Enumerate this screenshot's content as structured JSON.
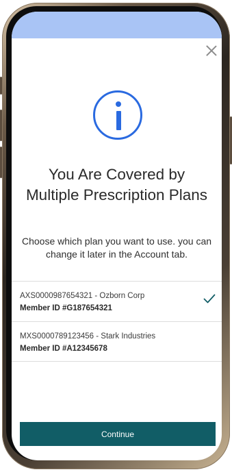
{
  "modal": {
    "title": "You Are Covered by Multiple Prescription Plans",
    "subtitle": "Choose which plan you want to use. you can change it later in the Account tab.",
    "close_icon": "close-icon",
    "info_icon": "info-icon"
  },
  "plans": [
    {
      "name": "AXS0000987654321 - Ozborn Corp",
      "member": "Member ID #G187654321",
      "selected": true
    },
    {
      "name": "MXS0000789123456 - Stark Industries",
      "member": "Member ID #A12345678",
      "selected": false
    }
  ],
  "actions": {
    "continue_label": "Continue"
  },
  "colors": {
    "accent": "#2a6ae0",
    "primary_button": "#115d66",
    "check": "#115d66",
    "banner": "#a9c4f5"
  }
}
